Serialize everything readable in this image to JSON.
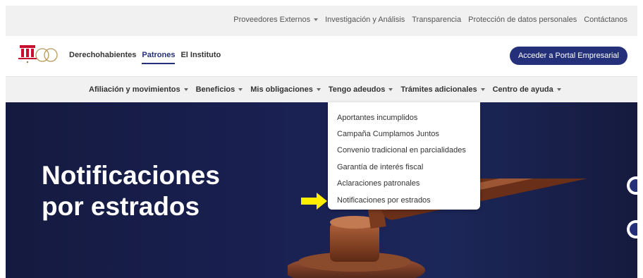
{
  "utility_bar": {
    "links": [
      {
        "label": "Proveedores Externos",
        "has_caret": true
      },
      {
        "label": "Investigación y Análisis",
        "has_caret": false
      },
      {
        "label": "Transparencia",
        "has_caret": false
      },
      {
        "label": "Protección de datos personales",
        "has_caret": false
      },
      {
        "label": "Contáctanos",
        "has_caret": false
      }
    ]
  },
  "header": {
    "logo_icon": "imss-logo-icon",
    "nav": [
      {
        "label": "Derechohabientes",
        "active": false
      },
      {
        "label": "Patrones",
        "active": true
      },
      {
        "label": "El Instituto",
        "active": false
      }
    ],
    "portal_button": "Acceder a Portal Empresarial"
  },
  "sub_nav": {
    "items": [
      {
        "label": "Afiliación y movimientos"
      },
      {
        "label": "Beneficios"
      },
      {
        "label": "Mis obligaciones"
      },
      {
        "label": "Tengo adeudos"
      },
      {
        "label": "Trámites adicionales"
      },
      {
        "label": "Centro de ayuda"
      }
    ]
  },
  "dropdown": {
    "items": [
      {
        "label": "Aportantes incumplidos"
      },
      {
        "label": "Campaña Cumplamos Juntos"
      },
      {
        "label": "Convenio tradicional en parcialidades"
      },
      {
        "label": "Garantía de interés fiscal"
      },
      {
        "label": "Aclaraciones patronales"
      },
      {
        "label": "Notificaciones por estrados"
      }
    ]
  },
  "hero": {
    "title_line1": "Notificaciones",
    "title_line2": "por estrados"
  },
  "annotation": {
    "arrow_icon": "yellow-arrow-icon",
    "color": "#ffee00"
  },
  "colors": {
    "brand": "#24317a",
    "hero_background": "#1a2153"
  }
}
